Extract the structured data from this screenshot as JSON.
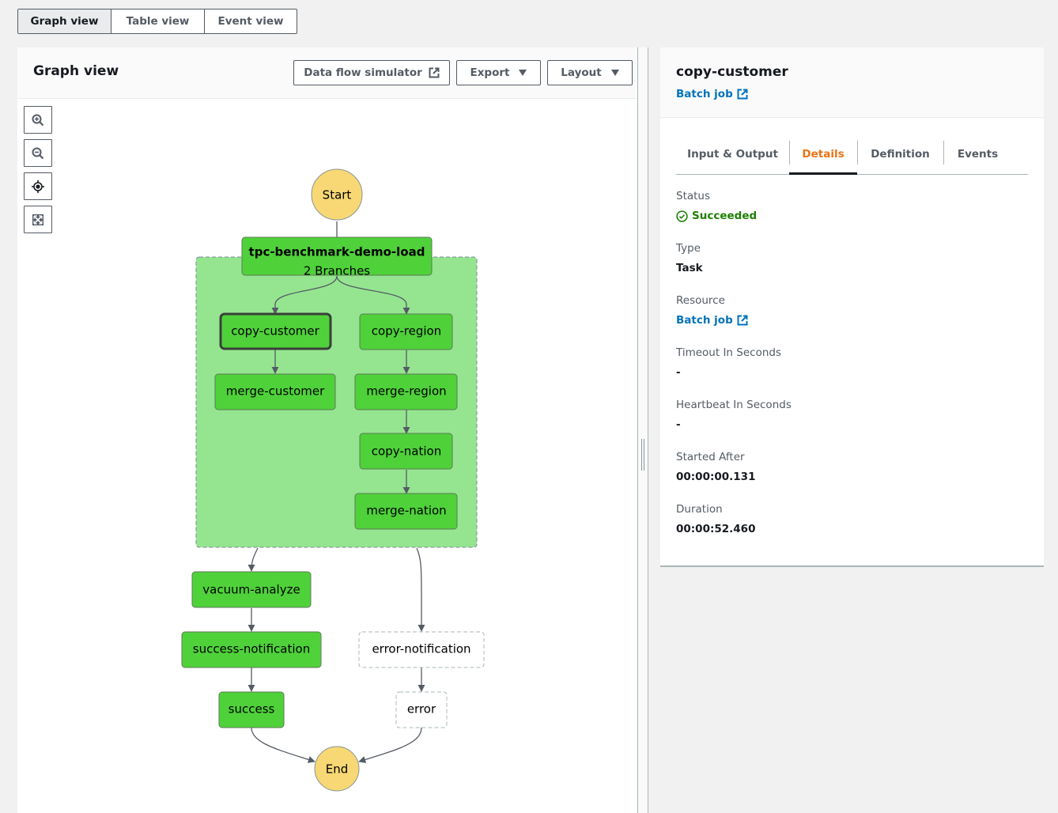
{
  "view_tabs": [
    {
      "label": "Graph view",
      "active": true
    },
    {
      "label": "Table view",
      "active": false
    },
    {
      "label": "Event view",
      "active": false
    }
  ],
  "graph_panel": {
    "title": "Graph view",
    "buttons": {
      "data_flow_simulator": "Data flow simulator",
      "export": "Export",
      "layout": "Layout"
    },
    "controls": [
      "zoom-in",
      "zoom-out",
      "center",
      "fit-to-screen"
    ]
  },
  "graph": {
    "start_label": "Start",
    "end_label": "End",
    "parallel": {
      "name": "tpc-benchmark-demo-load",
      "subtitle": "2 Branches"
    },
    "nodes": {
      "copy_customer": {
        "label": "copy-customer",
        "status": "succeeded",
        "selected": true
      },
      "merge_customer": {
        "label": "merge-customer",
        "status": "succeeded"
      },
      "copy_region": {
        "label": "copy-region",
        "status": "succeeded"
      },
      "merge_region": {
        "label": "merge-region",
        "status": "succeeded"
      },
      "copy_nation": {
        "label": "copy-nation",
        "status": "succeeded"
      },
      "merge_nation": {
        "label": "merge-nation",
        "status": "succeeded"
      },
      "vacuum_analyze": {
        "label": "vacuum-analyze",
        "status": "succeeded"
      },
      "success_notification": {
        "label": "success-notification",
        "status": "succeeded"
      },
      "success": {
        "label": "success",
        "status": "succeeded"
      },
      "error_notification": {
        "label": "error-notification",
        "status": "not-run"
      },
      "error": {
        "label": "error",
        "status": "not-run"
      }
    },
    "colors": {
      "succeeded": "#4fd13a",
      "parallel_bg": "#95e590",
      "terminal": "#f8d874",
      "not_run": "#ffffff"
    }
  },
  "details": {
    "title": "copy-customer",
    "resource_link": "Batch job",
    "tabs": [
      {
        "label": "Input & Output",
        "active": false
      },
      {
        "label": "Details",
        "active": true
      },
      {
        "label": "Definition",
        "active": false
      },
      {
        "label": "Events",
        "active": false
      }
    ],
    "fields": {
      "status": {
        "label": "Status",
        "value": "Succeeded"
      },
      "type": {
        "label": "Type",
        "value": "Task"
      },
      "resource": {
        "label": "Resource",
        "value": "Batch job"
      },
      "timeout": {
        "label": "Timeout In Seconds",
        "value": "-"
      },
      "heartbeat": {
        "label": "Heartbeat In Seconds",
        "value": "-"
      },
      "started_after": {
        "label": "Started After",
        "value": "00:00:00.131"
      },
      "duration": {
        "label": "Duration",
        "value": "00:00:52.460"
      }
    },
    "colors": {
      "link": "#0073bb",
      "active_tab": "#ec7211",
      "success": "#1d8102"
    }
  }
}
